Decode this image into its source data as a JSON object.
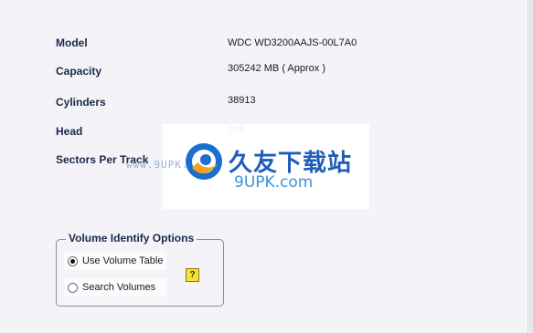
{
  "drive_info": [
    {
      "label": "Model",
      "value": "WDC WD3200AAJS-00L7A0"
    },
    {
      "label": "Capacity",
      "value": "305242 MB ( Approx )"
    },
    {
      "label": "Cylinders",
      "value": "38913"
    },
    {
      "label": "Head",
      "value": "255"
    },
    {
      "label": "Sectors Per Track",
      "value": ""
    }
  ],
  "volume_options": {
    "title": "Volume Identify Options",
    "options": [
      {
        "label": "Use Volume Table",
        "selected": true
      },
      {
        "label": "Search Volumes",
        "selected": false
      }
    ],
    "help_label": "?"
  },
  "watermark": {
    "url_text": "www.9UPK.com",
    "cn_text": "久友下载站",
    "en_text": "9UPK.com"
  },
  "colors": {
    "label_text": "#1a2a4a",
    "background": "#f4f3f7",
    "watermark_blue": "#1e5eb8",
    "help_yellow": "#f6e233"
  }
}
